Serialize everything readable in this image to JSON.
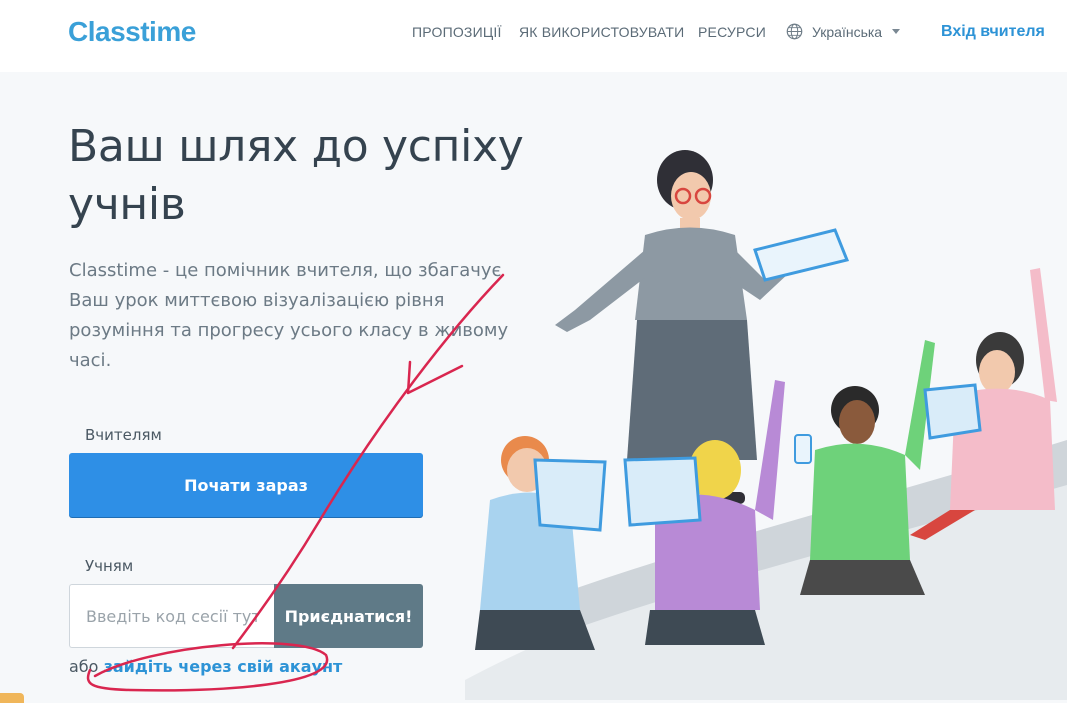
{
  "header": {
    "logo_text": "Classtime",
    "nav": [
      "ПРОПОЗИЦІЇ",
      "ЯК ВИКОРИСТОВУВАТИ",
      "РЕСУРСИ"
    ],
    "language": "Українська",
    "login_label": "Вхід вчителя"
  },
  "hero": {
    "title": "Ваш шлях до успіху учнів",
    "subtitle": "Classtime - це помічник вчителя, що збагачує Ваш урок миттєвою візуалізацією рівня розуміння та прогресу усього класу в живому часі."
  },
  "teachers": {
    "label": "Вчителям",
    "button": "Почати зараз"
  },
  "students": {
    "label": "Учням",
    "code_placeholder": "Введіть код сесії тут",
    "join_button": "Приєднатися!"
  },
  "alt_login": {
    "prefix": "або",
    "link": "зайдіть через свій акаунт"
  },
  "colors": {
    "brand": "#3aa0d8",
    "primary_button": "#2e8fe6",
    "join_button": "#5f7a87",
    "annotation": "#d9264f"
  }
}
